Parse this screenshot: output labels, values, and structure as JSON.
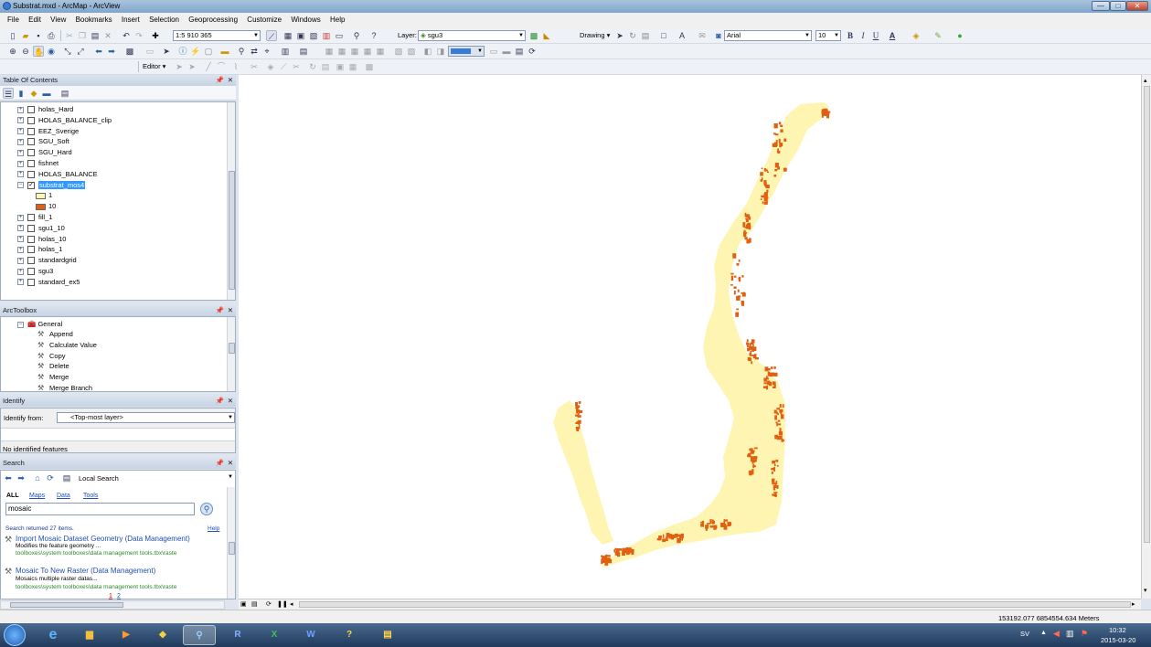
{
  "window": {
    "title": "Substrat.mxd - ArcMap - ArcView",
    "min": "—",
    "max": "□",
    "close": "✕"
  },
  "menu": [
    "File",
    "Edit",
    "View",
    "Bookmarks",
    "Insert",
    "Selection",
    "Geoprocessing",
    "Customize",
    "Windows",
    "Help"
  ],
  "toolbar": {
    "scale": "1:5 910 365",
    "layer_label": "Layer:",
    "layer_value": "sgu3",
    "drawing_label": "Drawing ▾",
    "font_name": "Arial",
    "font_size": "10",
    "bold": "B",
    "italic": "I",
    "underline": "U",
    "font_color": "A",
    "editor_label": "Editor ▾"
  },
  "toc": {
    "title": "Table Of Contents",
    "layers": [
      {
        "name": "holas_Hard",
        "checked": false
      },
      {
        "name": "HOLAS_BALANCE_clip",
        "checked": false
      },
      {
        "name": "EEZ_Sverige",
        "checked": false
      },
      {
        "name": "SGU_Soft",
        "checked": false
      },
      {
        "name": "SGU_Hard",
        "checked": false
      },
      {
        "name": "fishnet",
        "checked": false
      },
      {
        "name": "HOLAS_BALANCE",
        "checked": false
      },
      {
        "name": "substrat_mos4",
        "checked": true,
        "selected": true
      },
      {
        "name": "fill_1",
        "checked": false
      },
      {
        "name": "sgu1_10",
        "checked": false
      },
      {
        "name": "holas_10",
        "checked": false
      },
      {
        "name": "holas_1",
        "checked": false
      },
      {
        "name": "standardgrid",
        "checked": false
      },
      {
        "name": "sgu3",
        "checked": false
      },
      {
        "name": "standard_ex5",
        "checked": false
      }
    ],
    "legend": [
      {
        "label": "1",
        "color": "#fff5b3"
      },
      {
        "label": "10",
        "color": "#e0600f"
      }
    ]
  },
  "arctoolbox": {
    "title": "ArcToolbox",
    "group": "General",
    "tools": [
      "Append",
      "Calculate Value",
      "Copy",
      "Delete",
      "Merge",
      "Merge Branch"
    ]
  },
  "identify": {
    "title": "Identify",
    "from_label": "Identify from:",
    "from_value": "<Top-most layer>",
    "status": "No identified features"
  },
  "search": {
    "title": "Search",
    "scope": "Local Search",
    "tabs": [
      "ALL",
      "Maps",
      "Data",
      "Tools"
    ],
    "query": "mosaic",
    "result_count": "Search returned 27 items.",
    "help": "Help",
    "results": [
      {
        "title": "Import Mosaic Dataset Geometry (Data Management)",
        "desc": "Modifies the feature geometry ...",
        "path": "toolboxes\\system toolboxes\\data management tools.tbx\\raste"
      },
      {
        "title": "Mosaic To New Raster (Data Management)",
        "desc": "Mosaics multiple raster datas...",
        "path": "toolboxes\\system toolboxes\\data management tools.tbx\\raste"
      }
    ],
    "pages": [
      "1",
      "2"
    ]
  },
  "map": {
    "coords": "153192.077  6854554.634 Meters",
    "color_class_1": "#fff5b3",
    "color_class_10": "#e0600f"
  },
  "taskbar": {
    "apps": [
      "IE",
      "Explorer",
      "Media",
      "Python",
      "ArcMap",
      "R",
      "Excel",
      "Word",
      "Help",
      "ArcCatalog"
    ],
    "lang": "SV",
    "time": "10:32",
    "date": "2015-03-20"
  }
}
